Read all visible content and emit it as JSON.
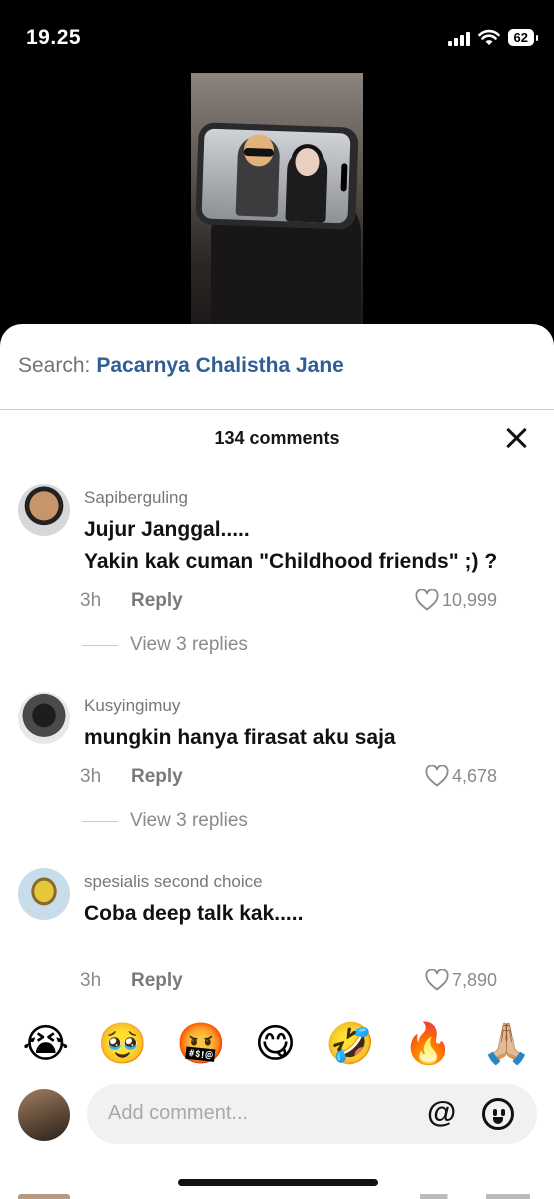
{
  "status_bar": {
    "time": "19.25",
    "battery": "62"
  },
  "search": {
    "prefix": "Search:",
    "term": "Pacarnya Chalistha Jane"
  },
  "comments_header": {
    "count_label": "134 comments"
  },
  "comments": [
    {
      "user": "Sapiberguling",
      "text_lines": [
        "Jujur Janggal.....",
        "Yakin kak cuman \"Childhood friends\" ;) ?"
      ],
      "time": "3h",
      "reply_label": "Reply",
      "likes": "10,999",
      "view_replies": "View 3 replies"
    },
    {
      "user": "Kusyingimuy",
      "text_lines": [
        "mungkin hanya firasat aku saja"
      ],
      "time": "3h",
      "reply_label": "Reply",
      "likes": "4,678",
      "view_replies": "View 3 replies"
    },
    {
      "user": "spesialis second choice",
      "text_lines": [
        "Coba deep talk kak....."
      ],
      "time": "3h",
      "reply_label": "Reply",
      "likes": "7,890"
    }
  ],
  "emoji_bar": [
    "😭",
    "🥹",
    "🤬",
    "😋",
    "🤣",
    "🔥",
    "🙏🏼"
  ],
  "input": {
    "placeholder": "Add comment...",
    "mention_icon": "@"
  },
  "icons": [
    "signal-icon",
    "wifi-icon",
    "battery-icon",
    "close-icon",
    "heart-icon",
    "at-icon",
    "emoji-icon"
  ]
}
